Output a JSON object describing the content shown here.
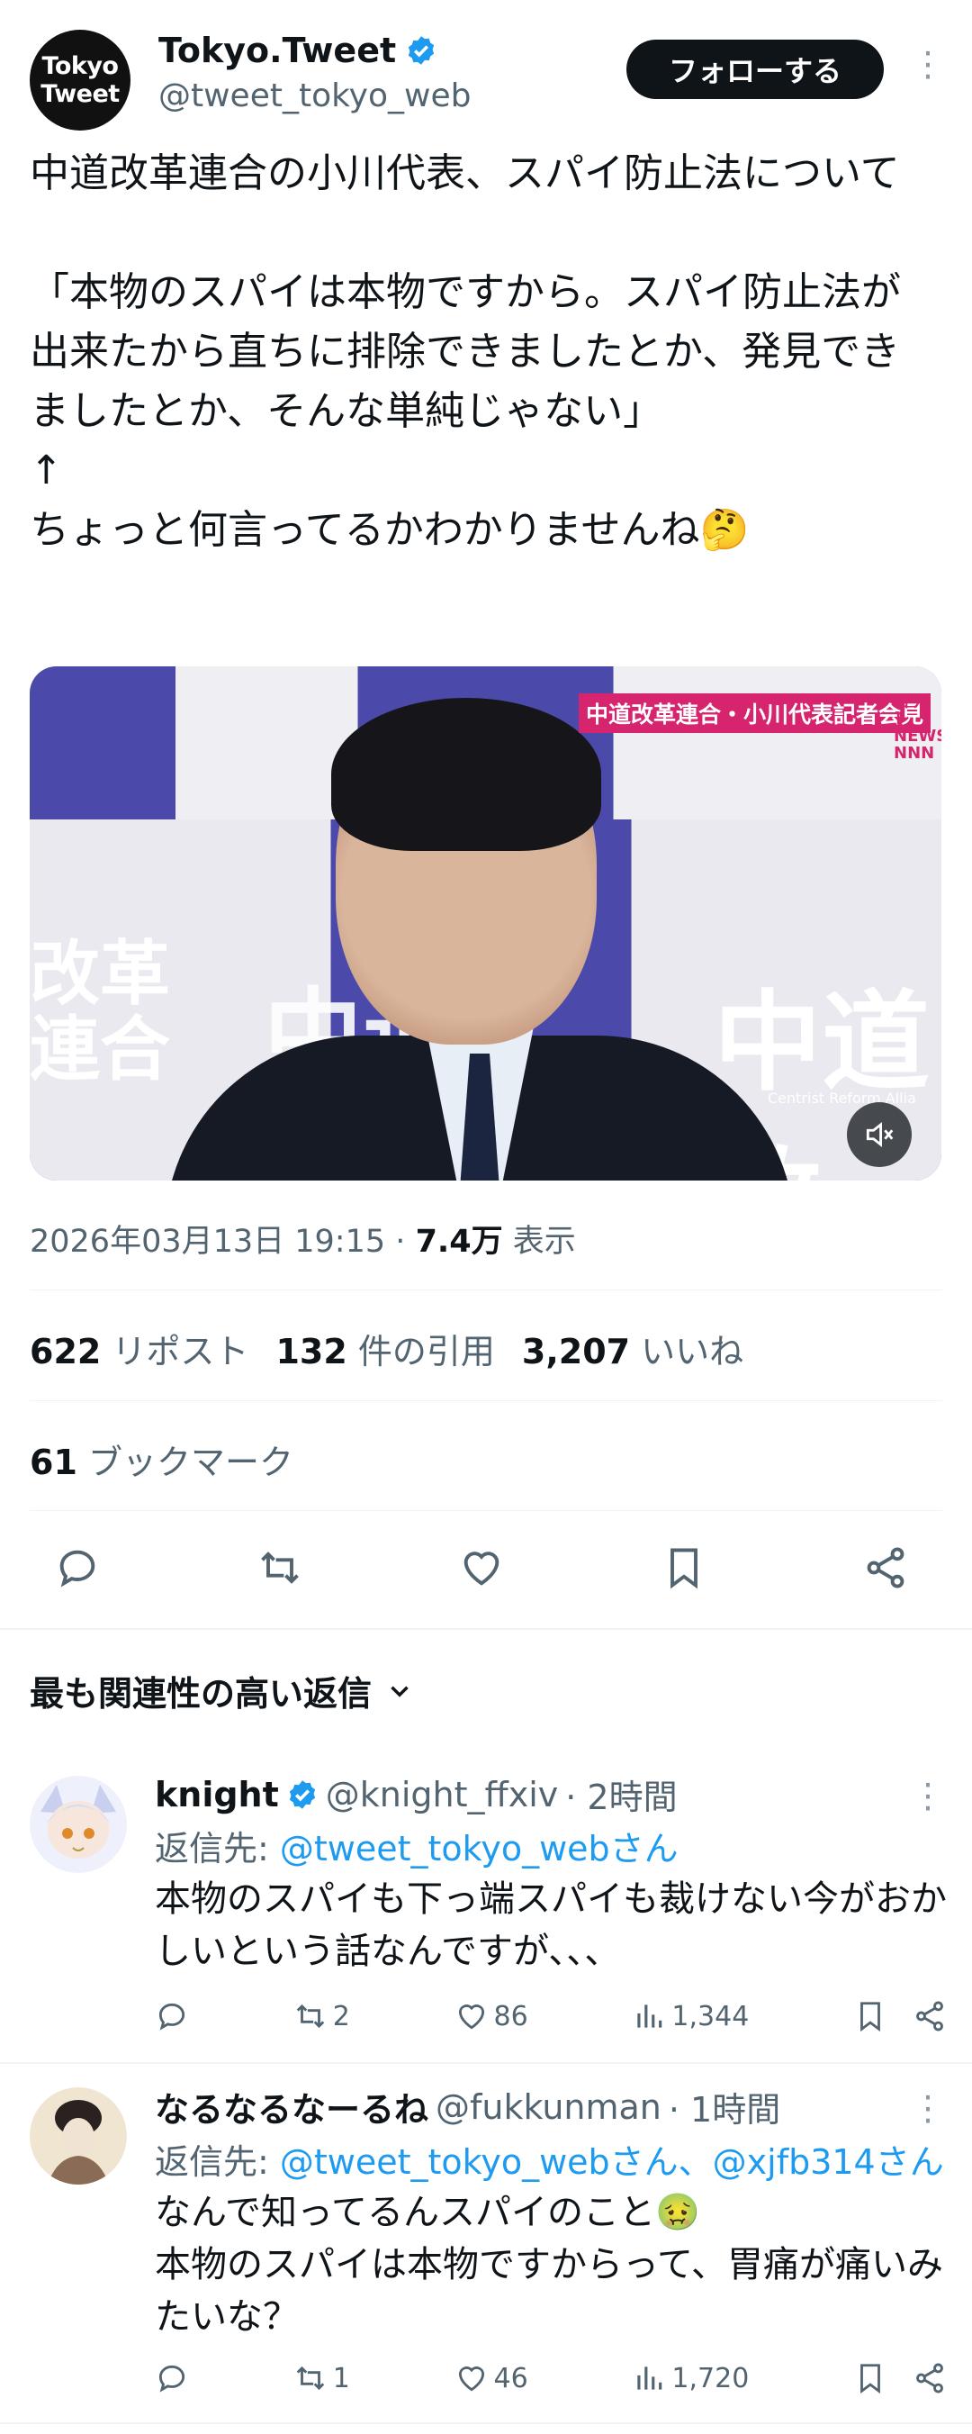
{
  "author": {
    "avatar_text_1": "Tokyo",
    "avatar_text_2": "Tweet",
    "name": "Tokyo.Tweet",
    "handle": "@tweet_tokyo_web",
    "follow_label": "フォローする"
  },
  "tweet": {
    "text": "中道改革連合の小川代表、スパイ防止法について\n\n「本物のスパイは本物ですから。スパイ防止法が出来たから直ちに排除できましたとか、発見できましたとか、そんな単純じゃない」\n↑\nちょっと何言ってるかわかりませんね🤔",
    "media": {
      "banner": "中道改革連合・小川代表記者会見",
      "logo": "日テレ NEWS NNN",
      "wall_left": "改革\n連合",
      "wall_mid": "中道",
      "wall_right": "中道改",
      "wall_sub": "Centrist Reform Allia"
    },
    "date": "2026年03月13日 19:15",
    "separator": "·",
    "views": "7.4万",
    "views_label": "表示"
  },
  "stats": {
    "reposts": "622",
    "reposts_label": "リポスト",
    "quotes": "132",
    "quotes_label": "件の引用",
    "likes": "3,207",
    "likes_label": "いいね",
    "bookmarks": "61",
    "bookmarks_label": "ブックマーク"
  },
  "sort_label": "最も関連性の高い返信",
  "replies": [
    {
      "name": "knight",
      "handle": "@knight_ffxiv",
      "time": "· 2時間",
      "reply_to_prefix": "返信先: ",
      "reply_to": "@tweet_tokyo_webさん",
      "text": "本物のスパイも下っ端スパイも裁けない今がおかしいという話なんですが、、、",
      "retweets": "2",
      "likes": "86",
      "views": "1,344"
    },
    {
      "name": "なるなるなーるね",
      "handle": "@fukkunman",
      "time": "· 1時間",
      "reply_to_prefix": "返信先: ",
      "reply_to": "@tweet_tokyo_webさん、@xjfb314さん",
      "text": "なんで知ってるんスパイのこと🤢\n本物のスパイは本物ですからって、胃痛が痛いみたいな？",
      "retweets": "1",
      "likes": "46",
      "views": "1,720"
    }
  ],
  "colors": {
    "accent": "#1d9bf0",
    "text": "#0f1419",
    "muted": "#536471",
    "divider": "#eff3f4"
  }
}
